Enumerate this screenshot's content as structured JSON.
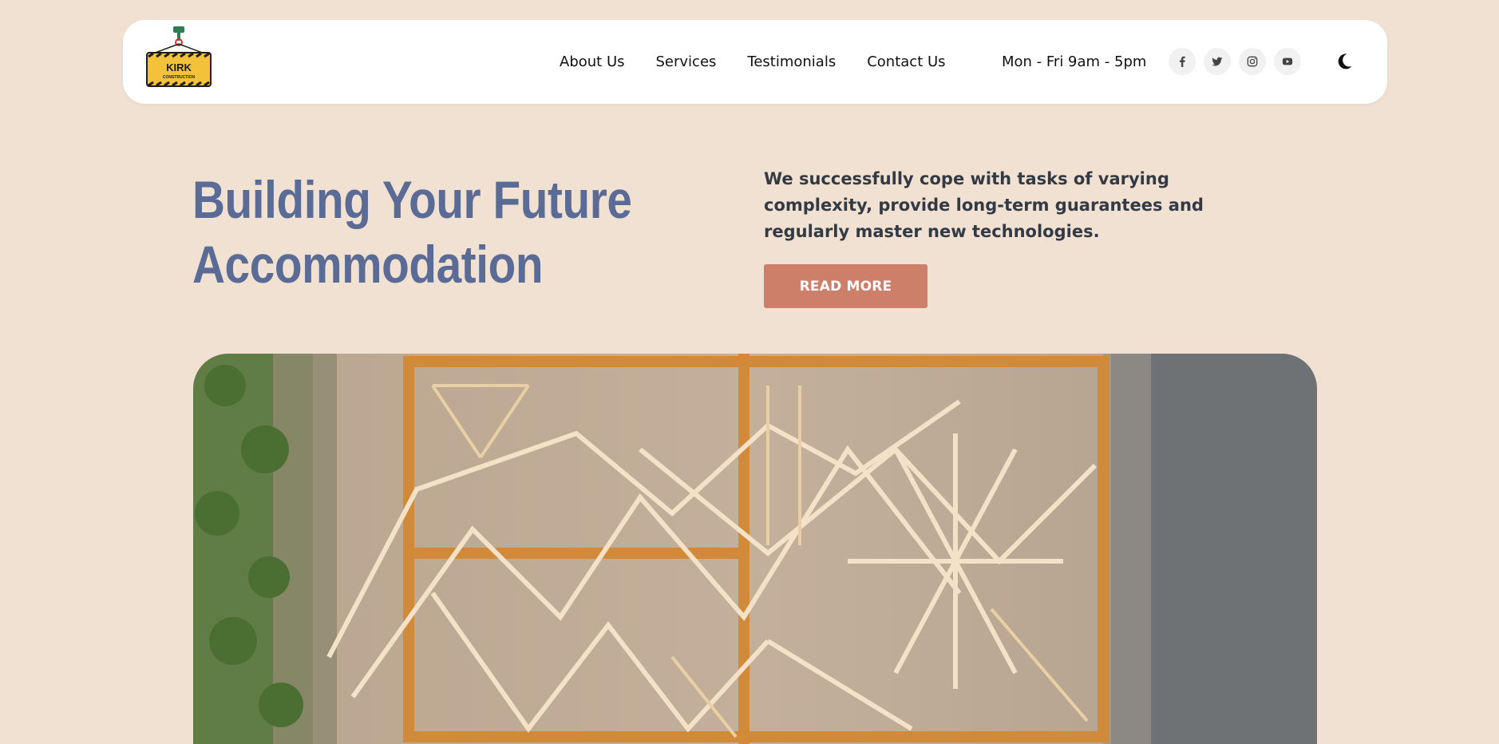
{
  "header": {
    "logo": {
      "text_main": "KIRK",
      "text_sub": "CONSTRUCTION",
      "colors": {
        "sign": "#f3c13a",
        "hazard": "#1d1d1d",
        "crane": "#2e7d4f"
      }
    },
    "nav": [
      {
        "label": "About Us"
      },
      {
        "label": "Services"
      },
      {
        "label": "Testimonials"
      },
      {
        "label": "Contact Us"
      }
    ],
    "hours": "Mon - Fri 9am - 5pm",
    "socials": [
      {
        "icon": "facebook-icon"
      },
      {
        "icon": "twitter-icon"
      },
      {
        "icon": "instagram-icon"
      },
      {
        "icon": "youtube-icon"
      }
    ],
    "theme_toggle_icon": "moon-icon"
  },
  "hero": {
    "title_line1": "Building Your Future",
    "title_line2": "Accommodation",
    "description": "We successfully cope with tasks of varying complexity, provide long-term guarantees and regularly master new technologies.",
    "cta_label": "READ MORE",
    "image_subject": "aerial view of wooden house framing under construction"
  },
  "colors": {
    "page_background": "#f0e1d3",
    "title": "#5a6b95",
    "cta": "#cd7f69",
    "body_text": "#333a44"
  }
}
